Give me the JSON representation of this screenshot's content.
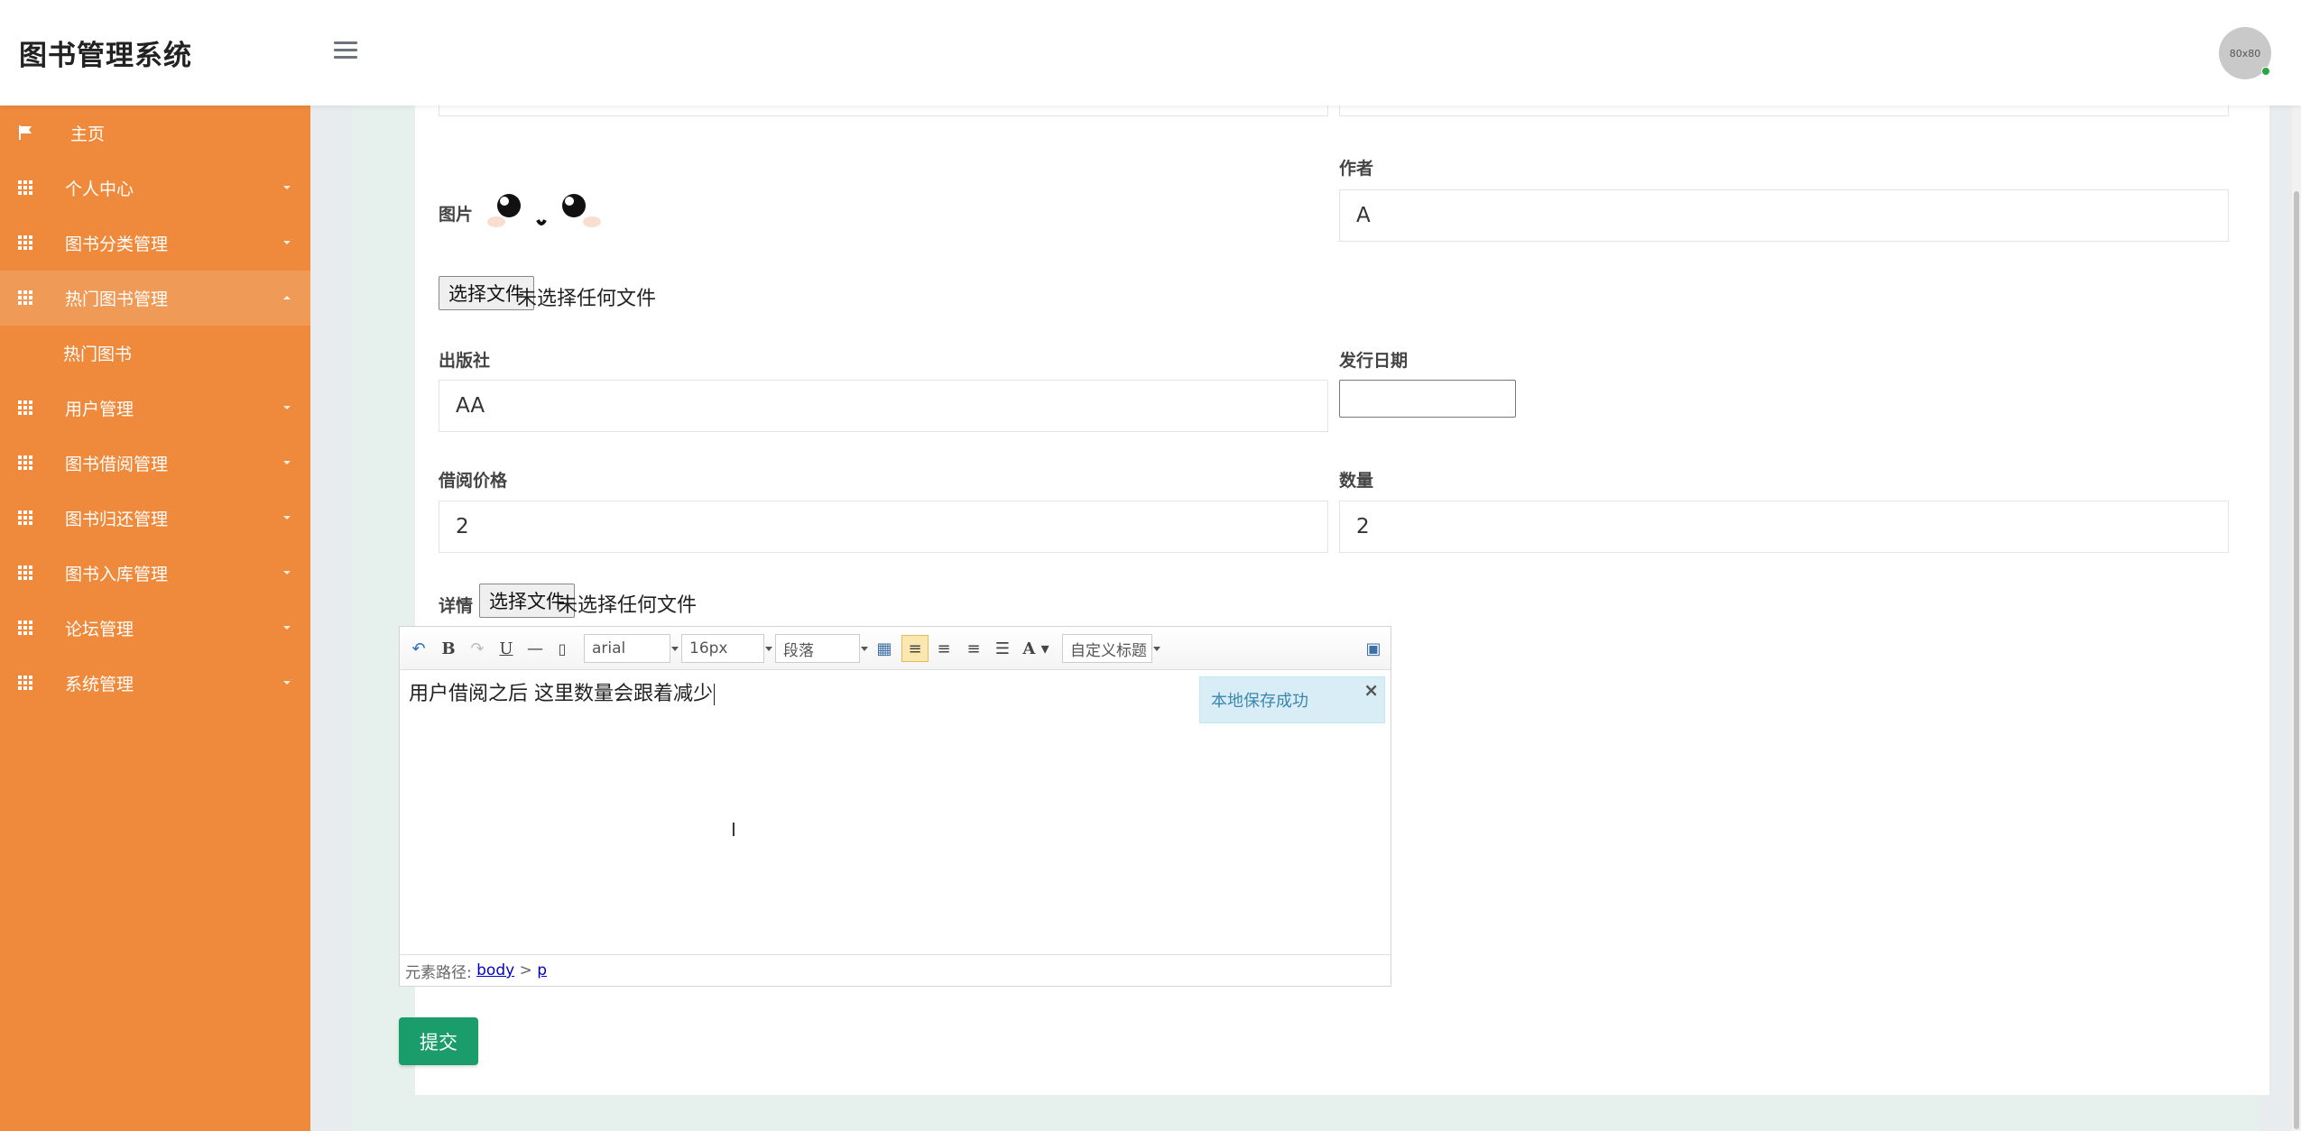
{
  "header": {
    "app_title": "图书管理系统",
    "avatar_text": "80x80"
  },
  "sidebar": {
    "items": [
      {
        "label": "主页"
      },
      {
        "label": "个人中心"
      },
      {
        "label": "图书分类管理"
      },
      {
        "label": "热门图书管理"
      },
      {
        "label": "热门图书"
      },
      {
        "label": "用户管理"
      },
      {
        "label": "图书借阅管理"
      },
      {
        "label": "图书归还管理"
      },
      {
        "label": "图书入库管理"
      },
      {
        "label": "论坛管理"
      },
      {
        "label": "系统管理"
      }
    ]
  },
  "form": {
    "image_label": "图片",
    "author_label": "作者",
    "author_value": "A",
    "file_button": "选择文件",
    "file_none": "未选择任何文件",
    "publisher_label": "出版社",
    "publisher_value": "AA",
    "release_date_label": "发行日期",
    "price_label": "借阅价格",
    "price_value": "2",
    "quantity_label": "数量",
    "quantity_value": "2",
    "detail_label": "详情",
    "submit_label": "提交"
  },
  "editor": {
    "font_family": "arial",
    "font_size": "16px",
    "paragraph": "段落",
    "custom_title": "自定义标题",
    "content": "用户借阅之后  这里数量会跟着减少",
    "toast": "本地保存成功",
    "path_label": "元素路径:",
    "path_body": "body",
    "path_sep": ">",
    "path_p": "p"
  },
  "colors": {
    "sidebar_bg": "#ef8a3c",
    "submit_bg": "#1b9d6b"
  }
}
